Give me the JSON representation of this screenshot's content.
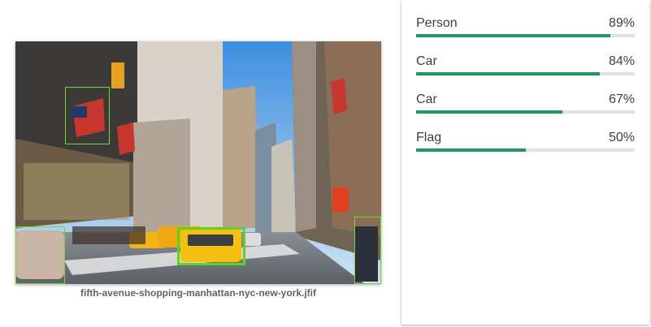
{
  "image": {
    "filename": "fifth-avenue-shopping-manhattan-nyc-new-york.jfif",
    "description_icon": "street-photo"
  },
  "detections": [
    {
      "label": "Person",
      "score_text": "89%",
      "score": 0.89
    },
    {
      "label": "Car",
      "score_text": "84%",
      "score": 0.84
    },
    {
      "label": "Car",
      "score_text": "67%",
      "score": 0.67
    },
    {
      "label": "Flag",
      "score_text": "50%",
      "score": 0.5
    }
  ],
  "colors": {
    "bar_fill": "#1f9a5a",
    "bar_track": "#e0e0e0",
    "bbox": "#76d433"
  }
}
